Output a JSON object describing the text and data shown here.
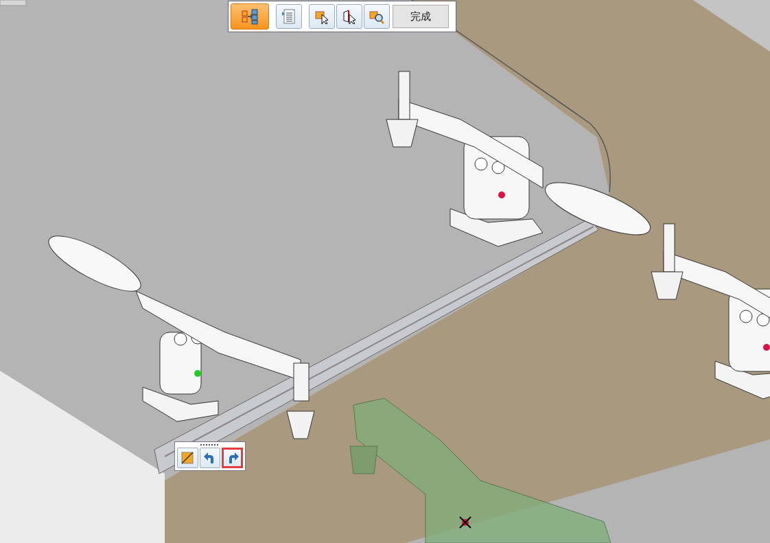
{
  "toolbar": {
    "buttons": [
      {
        "kind": "assembly",
        "selected": true
      },
      {
        "kind": "list",
        "selected": false
      },
      {
        "kind": "select-part",
        "selected": false
      },
      {
        "kind": "select-face",
        "selected": false
      },
      {
        "kind": "zoom-part",
        "selected": false
      }
    ],
    "done_button": {
      "label": "完成"
    }
  },
  "mini_toolbar": {
    "buttons": [
      {
        "kind": "flip",
        "highlighted": false
      },
      {
        "kind": "undo",
        "highlighted": false
      },
      {
        "kind": "redo",
        "highlighted": true
      }
    ]
  }
}
